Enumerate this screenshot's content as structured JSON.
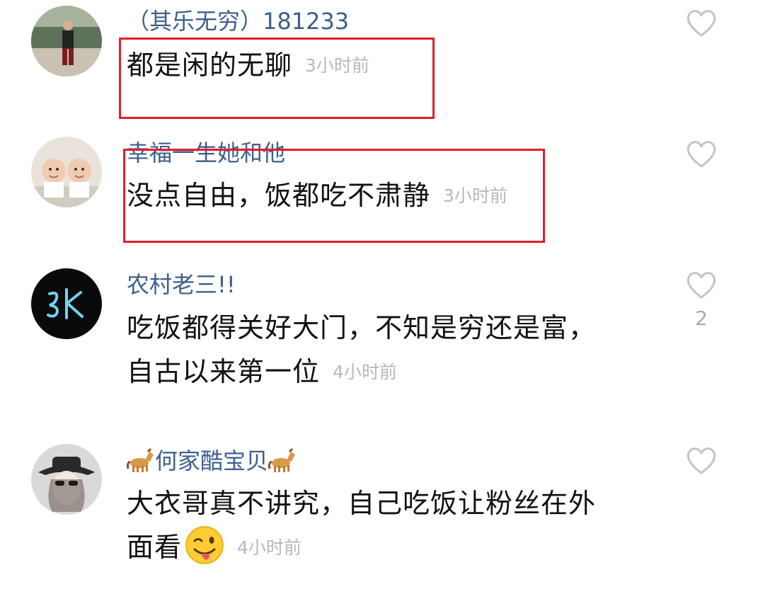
{
  "colors": {
    "username": "#3d5f8c",
    "text": "#111111",
    "time": "#b8b8b8",
    "highlight": "#e0202c",
    "like_icon": "#c4c4c4"
  },
  "comments": [
    {
      "username": "（其乐无穷）181233",
      "lines": [
        "都是闲的无聊"
      ],
      "time": "3小时前",
      "likes": "",
      "highlighted": true
    },
    {
      "username": "幸福一生她和他",
      "lines": [
        "没点自由，饭都吃不肃静"
      ],
      "time": "3小时前",
      "likes": "",
      "highlighted": true
    },
    {
      "username": "农村老三!!",
      "lines": [
        "吃饭都得关好大门，不知是穷还是富，",
        "自古以来第一位"
      ],
      "time": "4小时前",
      "likes": "2",
      "highlighted": false
    },
    {
      "username": "何家酷宝贝",
      "lines": [
        "大衣哥真不讲究，自己吃饭让粉丝在外",
        "面看"
      ],
      "time": "4小时前",
      "likes": "",
      "highlighted": false
    }
  ],
  "icons": {
    "like": "heart-outline-icon",
    "username_decoration": "horse-emoji-icon",
    "reaction": "winking-face-emoji-icon"
  }
}
